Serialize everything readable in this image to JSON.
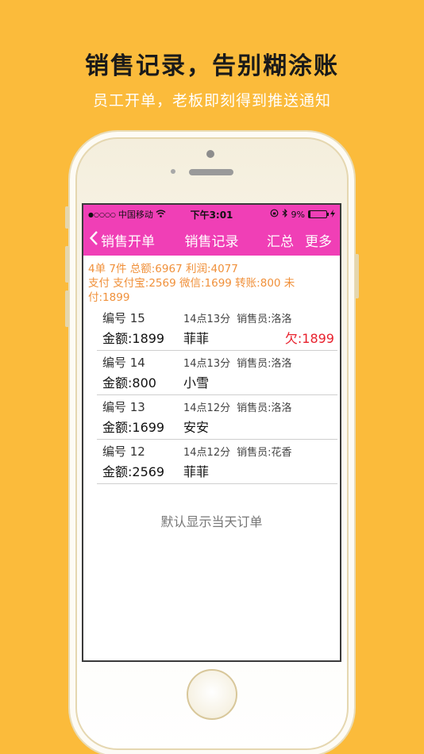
{
  "promo": {
    "headline": "销售记录，告别糊涂账",
    "subline": "员工开单，老板即刻得到推送通知"
  },
  "statusbar": {
    "signal": "●○○○○",
    "carrier": "中国移动",
    "wifi_icon": "wifi-icon",
    "time": "下午3:01",
    "lock_icon": "lock-rotation-icon",
    "bluetooth_icon": "bluetooth-icon",
    "battery": "9%",
    "battery_level": 0.09
  },
  "navbar": {
    "back_label": "销售开单",
    "title": "销售记录",
    "summary_label": "汇总",
    "more_label": "更多"
  },
  "summary": {
    "line1": "4单 7件 总额:6967 利润:4077",
    "line2": "支付  支付宝:2569 微信:1699 转账:800 未付:1899"
  },
  "orders": [
    {
      "number": "编号 15",
      "time": "14点13分",
      "seller": "销售员:洛洛",
      "amount": "金额:1899",
      "customer": "菲菲",
      "debt": "欠:1899"
    },
    {
      "number": "编号 14",
      "time": "14点13分",
      "seller": "销售员:洛洛",
      "amount": "金额:800",
      "customer": "小雪",
      "debt": ""
    },
    {
      "number": "编号 13",
      "time": "14点12分",
      "seller": "销售员:洛洛",
      "amount": "金额:1699",
      "customer": "安安",
      "debt": ""
    },
    {
      "number": "编号 12",
      "time": "14点12分",
      "seller": "销售员:花香",
      "amount": "金额:2569",
      "customer": "菲菲",
      "debt": ""
    }
  ],
  "footnote": "默认显示当天订单",
  "colors": {
    "background": "#FBBB3B",
    "nav": "#F03FB6",
    "summary_text": "#F0903A",
    "debt_text": "#E8202C"
  }
}
